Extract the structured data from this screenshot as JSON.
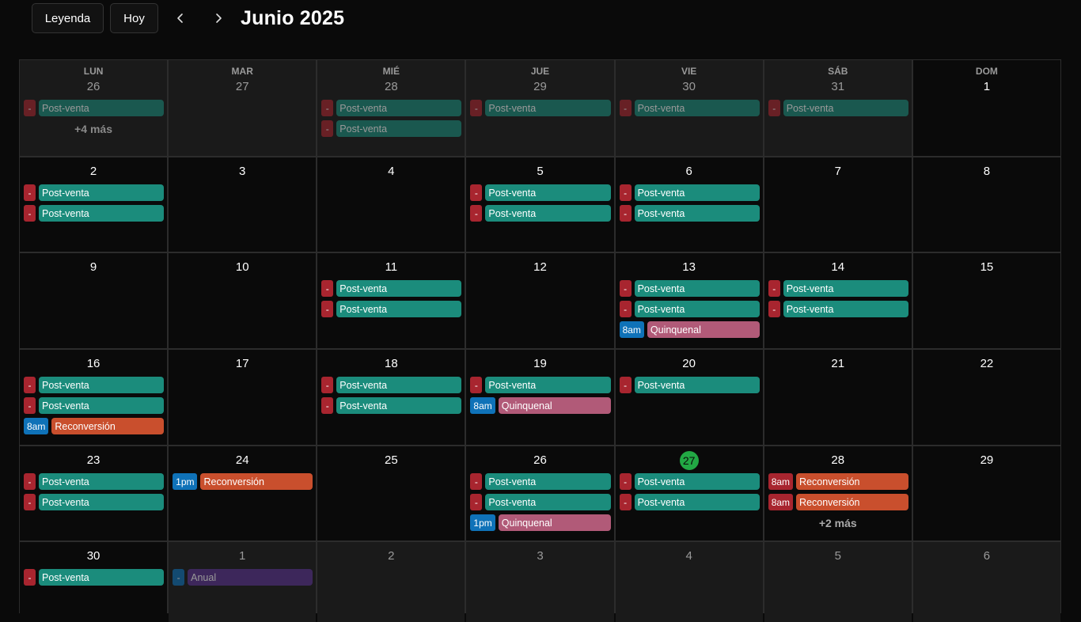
{
  "toolbar": {
    "legend_label": "Leyenda",
    "today_label": "Hoy",
    "prev_icon": "chevron-left-icon",
    "next_icon": "chevron-right-icon",
    "title": "Junio 2025"
  },
  "colors": {
    "post_venta": "#1b8c7c",
    "quincenal": "#b15a78",
    "reconversion": "#c94f2d",
    "anual": "#5b3391",
    "badge_red": "#a8252f",
    "badge_blue": "#0f72b8",
    "today": "#22a844"
  },
  "calendar": {
    "weekdays": [
      "LUN",
      "MAR",
      "MIÉ",
      "JUE",
      "VIE",
      "SÁB",
      "DOM"
    ],
    "weeks": [
      [
        {
          "day": "26",
          "dim": true,
          "events": [
            {
              "time": "-",
              "label": "Post-venta",
              "type": "post_venta"
            }
          ],
          "more": "+4 más"
        },
        {
          "day": "27",
          "dim": true,
          "events": []
        },
        {
          "day": "28",
          "dim": true,
          "events": [
            {
              "time": "-",
              "label": "Post-venta",
              "type": "post_venta"
            },
            {
              "time": "-",
              "label": "Post-venta",
              "type": "post_venta"
            }
          ]
        },
        {
          "day": "29",
          "dim": true,
          "events": [
            {
              "time": "-",
              "label": "Post-venta",
              "type": "post_venta"
            }
          ]
        },
        {
          "day": "30",
          "dim": true,
          "events": [
            {
              "time": "-",
              "label": "Post-venta",
              "type": "post_venta"
            }
          ]
        },
        {
          "day": "31",
          "dim": true,
          "events": [
            {
              "time": "-",
              "label": "Post-venta",
              "type": "post_venta"
            }
          ]
        },
        {
          "day": "1",
          "dim": false,
          "events": []
        }
      ],
      [
        {
          "day": "2",
          "events": [
            {
              "time": "-",
              "label": "Post-venta",
              "type": "post_venta"
            },
            {
              "time": "-",
              "label": "Post-venta",
              "type": "post_venta"
            }
          ]
        },
        {
          "day": "3",
          "events": []
        },
        {
          "day": "4",
          "events": []
        },
        {
          "day": "5",
          "events": [
            {
              "time": "-",
              "label": "Post-venta",
              "type": "post_venta"
            },
            {
              "time": "-",
              "label": "Post-venta",
              "type": "post_venta"
            }
          ]
        },
        {
          "day": "6",
          "events": [
            {
              "time": "-",
              "label": "Post-venta",
              "type": "post_venta"
            },
            {
              "time": "-",
              "label": "Post-venta",
              "type": "post_venta"
            }
          ]
        },
        {
          "day": "7",
          "events": []
        },
        {
          "day": "8",
          "events": []
        }
      ],
      [
        {
          "day": "9",
          "events": []
        },
        {
          "day": "10",
          "events": []
        },
        {
          "day": "11",
          "events": [
            {
              "time": "-",
              "label": "Post-venta",
              "type": "post_venta"
            },
            {
              "time": "-",
              "label": "Post-venta",
              "type": "post_venta"
            }
          ]
        },
        {
          "day": "12",
          "events": []
        },
        {
          "day": "13",
          "events": [
            {
              "time": "-",
              "label": "Post-venta",
              "type": "post_venta"
            },
            {
              "time": "-",
              "label": "Post-venta",
              "type": "post_venta"
            },
            {
              "time": "8am",
              "label": "Quinquenal",
              "type": "quincenal",
              "badge": "blue"
            }
          ]
        },
        {
          "day": "14",
          "events": [
            {
              "time": "-",
              "label": "Post-venta",
              "type": "post_venta"
            },
            {
              "time": "-",
              "label": "Post-venta",
              "type": "post_venta"
            }
          ]
        },
        {
          "day": "15",
          "events": []
        }
      ],
      [
        {
          "day": "16",
          "events": [
            {
              "time": "-",
              "label": "Post-venta",
              "type": "post_venta"
            },
            {
              "time": "-",
              "label": "Post-venta",
              "type": "post_venta"
            },
            {
              "time": "8am",
              "label": "Reconversión",
              "type": "reconversion",
              "badge": "blue"
            }
          ]
        },
        {
          "day": "17",
          "events": []
        },
        {
          "day": "18",
          "events": [
            {
              "time": "-",
              "label": "Post-venta",
              "type": "post_venta"
            },
            {
              "time": "-",
              "label": "Post-venta",
              "type": "post_venta"
            }
          ]
        },
        {
          "day": "19",
          "events": [
            {
              "time": "-",
              "label": "Post-venta",
              "type": "post_venta"
            },
            {
              "time": "8am",
              "label": "Quinquenal",
              "type": "quincenal",
              "badge": "blue"
            }
          ]
        },
        {
          "day": "20",
          "events": [
            {
              "time": "-",
              "label": "Post-venta",
              "type": "post_venta"
            }
          ]
        },
        {
          "day": "21",
          "events": []
        },
        {
          "day": "22",
          "events": []
        }
      ],
      [
        {
          "day": "23",
          "events": [
            {
              "time": "-",
              "label": "Post-venta",
              "type": "post_venta"
            },
            {
              "time": "-",
              "label": "Post-venta",
              "type": "post_venta"
            }
          ]
        },
        {
          "day": "24",
          "events": [
            {
              "time": "1pm",
              "label": "Reconversión",
              "type": "reconversion",
              "badge": "blue"
            }
          ]
        },
        {
          "day": "25",
          "events": []
        },
        {
          "day": "26",
          "events": [
            {
              "time": "-",
              "label": "Post-venta",
              "type": "post_venta"
            },
            {
              "time": "-",
              "label": "Post-venta",
              "type": "post_venta"
            },
            {
              "time": "1pm",
              "label": "Quinquenal",
              "type": "quincenal",
              "badge": "blue"
            }
          ]
        },
        {
          "day": "27",
          "today": true,
          "events": [
            {
              "time": "-",
              "label": "Post-venta",
              "type": "post_venta"
            },
            {
              "time": "-",
              "label": "Post-venta",
              "type": "post_venta"
            }
          ]
        },
        {
          "day": "28",
          "events": [
            {
              "time": "8am",
              "label": "Reconversión",
              "type": "reconversion",
              "badge": "red"
            },
            {
              "time": "8am",
              "label": "Reconversión",
              "type": "reconversion",
              "badge": "red"
            }
          ],
          "more": "+2 más"
        },
        {
          "day": "29",
          "events": []
        }
      ],
      [
        {
          "day": "30",
          "events": [
            {
              "time": "-",
              "label": "Post-venta",
              "type": "post_venta"
            }
          ]
        },
        {
          "day": "1",
          "dim": true,
          "events": [
            {
              "time": "-",
              "label": "Anual",
              "type": "anual",
              "badge": "blue"
            }
          ]
        },
        {
          "day": "2",
          "dim": true,
          "events": []
        },
        {
          "day": "3",
          "dim": true,
          "events": []
        },
        {
          "day": "4",
          "dim": true,
          "events": []
        },
        {
          "day": "5",
          "dim": true,
          "events": []
        },
        {
          "day": "6",
          "dim": true,
          "events": []
        }
      ]
    ]
  }
}
